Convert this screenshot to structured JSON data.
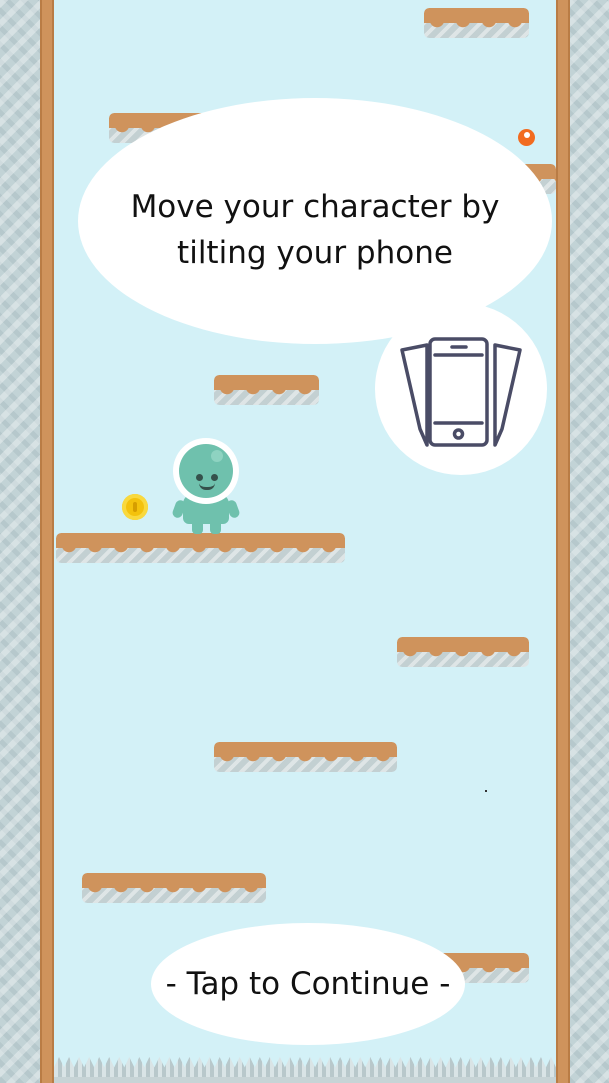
{
  "tutorial": {
    "message": "Move your character by tilting your phone",
    "continue_label": "- Tap to Continue -",
    "hint_icon": "tilt-phone-icon"
  },
  "game": {
    "character": "alien-astronaut",
    "collectibles": [
      "coin-icon",
      "orange-gem-icon"
    ]
  },
  "colors": {
    "sky": "#d3f1f7",
    "platform_dirt": "#cf935c",
    "platform_stone": "#c3d0d2",
    "character": "#6fc1ad",
    "coin": "#f4c20d",
    "gem": "#f26b1f"
  }
}
